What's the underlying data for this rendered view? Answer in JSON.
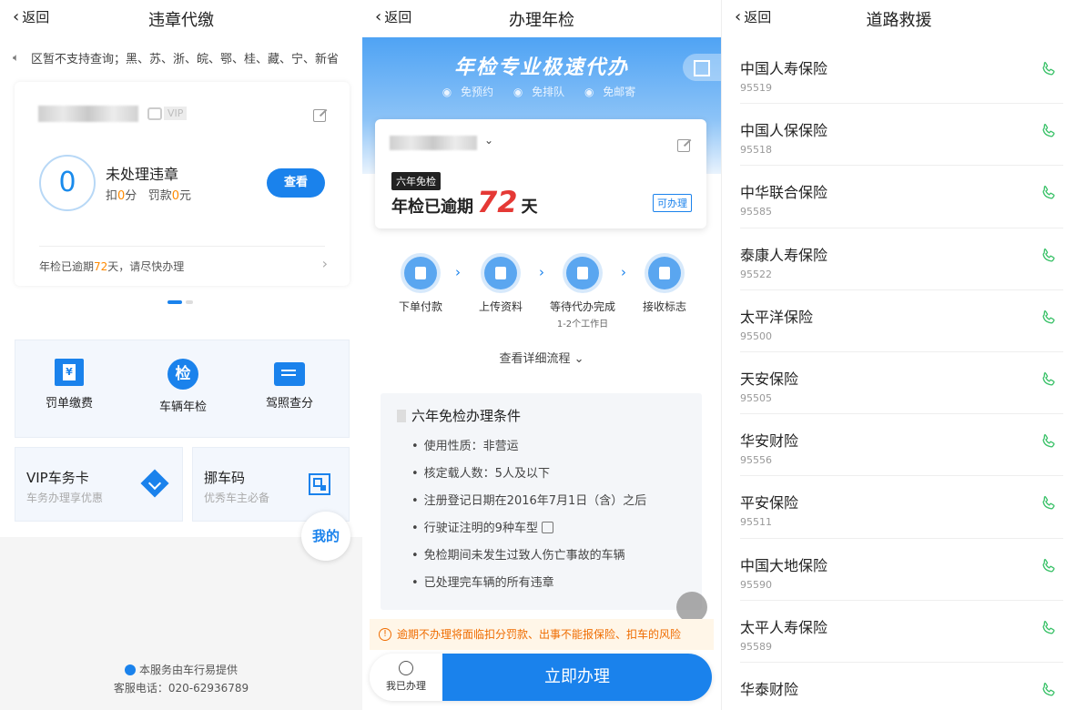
{
  "panel1": {
    "back_label": "返回",
    "title": "违章代缴",
    "notice": "区暂不支持查询；黑、苏、浙、皖、鄂、桂、藏、宁、新省",
    "vip_label": "VIP",
    "violations_count": "0",
    "unhandled_label": "未处理违章",
    "deduct_prefix": "扣",
    "deduct_points": "0",
    "deduct_points_unit": "分",
    "fine_prefix": "罚款",
    "fine_amount": "0",
    "fine_unit": "元",
    "check_button": "查看",
    "overdue_prefix": "年检已逾期",
    "overdue_days": "72",
    "overdue_suffix": "天，请尽快办理",
    "services": [
      {
        "label": "罚单缴费",
        "icon_char": "¥"
      },
      {
        "label": "车辆年检",
        "icon_char": "检"
      },
      {
        "label": "驾照查分"
      }
    ],
    "vip_card_title": "VIP车务卡",
    "vip_card_sub": "车务办理享优惠",
    "move_code_title": "挪车码",
    "move_code_sub": "优秀车主必备",
    "my_label": "我的",
    "provider_text": "本服务由车行易提供",
    "hotline": "客服电话：020-62936789"
  },
  "panel2": {
    "back_label": "返回",
    "title": "办理年检",
    "slogan": "年检专业极速代办",
    "perks": [
      "免预约",
      "免排队",
      "免邮寄"
    ],
    "six_year_badge": "六年免检",
    "overdue_prefix": "年检已逾期",
    "overdue_days": "72",
    "overdue_unit": "天",
    "can_handle": "可办理",
    "steps": [
      {
        "label": "下单付款",
        "sub": ""
      },
      {
        "label": "上传资料",
        "sub": ""
      },
      {
        "label": "等待代办完成",
        "sub": "1-2个工作日"
      },
      {
        "label": "接收标志",
        "sub": ""
      }
    ],
    "detail_link": "查看详细流程",
    "conditions_title": "六年免检办理条件",
    "conditions": [
      "使用性质：非营运",
      "核定载人数：5人及以下",
      "注册登记日期在2016年7月1日（含）之后",
      "行驶证注明的9种车型",
      "免检期间未发生过致人伤亡事故的车辆",
      "已处理完车辆的所有违章"
    ],
    "warning": "逾期不办理将面临扣分罚款、出事不能报保险、扣车的风险",
    "handled_label": "我已办理",
    "handle_now": "立即办理"
  },
  "panel3": {
    "back_label": "返回",
    "title": "道路救援",
    "insurers": [
      {
        "name": "中国人寿保险",
        "phone": "95519"
      },
      {
        "name": "中国人保保险",
        "phone": "95518"
      },
      {
        "name": "中华联合保险",
        "phone": "95585"
      },
      {
        "name": "泰康人寿保险",
        "phone": "95522"
      },
      {
        "name": "太平洋保险",
        "phone": "95500"
      },
      {
        "name": "天安保险",
        "phone": "95505"
      },
      {
        "name": "华安财险",
        "phone": "95556"
      },
      {
        "name": "平安保险",
        "phone": "95511"
      },
      {
        "name": "中国大地保险",
        "phone": "95590"
      },
      {
        "name": "太平人寿保险",
        "phone": "95589"
      },
      {
        "name": "华泰财险",
        "phone": ""
      }
    ]
  },
  "colors": {
    "accent": "#1a82ec",
    "orange": "#ff8a00",
    "red": "#e53935",
    "call_green": "#3cc26a"
  }
}
